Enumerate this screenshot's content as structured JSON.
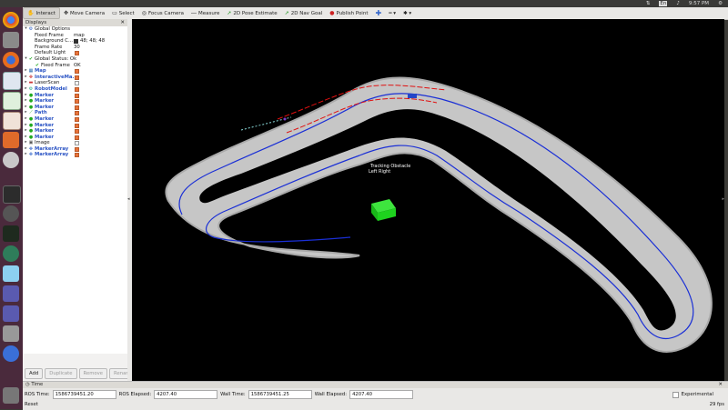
{
  "system_bar": {
    "time": "9:57 PM",
    "indicators": [
      "network-icon",
      "keyboard-icon",
      "volume-icon",
      "power-icon"
    ]
  },
  "toolbar": {
    "tools": [
      {
        "label": "Interact",
        "icon": "interact-icon",
        "active": true
      },
      {
        "label": "Move Camera",
        "icon": "move-camera-icon"
      },
      {
        "label": "Select",
        "icon": "select-icon"
      },
      {
        "label": "Focus Camera",
        "icon": "focus-camera-icon"
      },
      {
        "label": "Measure",
        "icon": "measure-icon"
      },
      {
        "label": "2D Pose Estimate",
        "icon": "pose-estimate-icon"
      },
      {
        "label": "2D Nav Goal",
        "icon": "nav-goal-icon"
      },
      {
        "label": "Publish Point",
        "icon": "publish-point-icon"
      }
    ],
    "extra_icons": [
      "add-tool-icon",
      "remove-tool-icon",
      "tool-options-icon"
    ]
  },
  "displays_panel": {
    "title": "Displays",
    "global_options": {
      "label": "Global Options",
      "fixed_frame": {
        "label": "Fixed Frame",
        "value": "map"
      },
      "background_color": {
        "label": "Background C...",
        "value": "48; 48; 48"
      },
      "frame_rate": {
        "label": "Frame Rate",
        "value": "30"
      },
      "default_light": {
        "label": "Default Light"
      }
    },
    "global_status": {
      "label": "Global Status: Ok",
      "child_label": "Fixed Frame",
      "child_value": "OK"
    },
    "displays": [
      {
        "label": "Map",
        "icon": "map-icon",
        "blue": true,
        "checked": true
      },
      {
        "label": "InteractiveMa...",
        "icon": "interactive-marker-icon",
        "blue": true,
        "checked": true
      },
      {
        "label": "LaserScan",
        "icon": "laserscan-icon",
        "blue": false,
        "checked": false
      },
      {
        "label": "RobotModel",
        "icon": "robot-model-icon",
        "blue": true,
        "checked": true
      },
      {
        "label": "Marker",
        "icon": "marker-icon",
        "blue": true,
        "checked": true
      },
      {
        "label": "Marker",
        "icon": "marker-icon",
        "blue": true,
        "checked": true
      },
      {
        "label": "Marker",
        "icon": "marker-icon",
        "blue": true,
        "checked": true
      },
      {
        "label": "Path",
        "icon": "path-icon",
        "blue": true,
        "checked": true
      },
      {
        "label": "Marker",
        "icon": "marker-icon",
        "blue": true,
        "checked": true
      },
      {
        "label": "Marker",
        "icon": "marker-icon",
        "blue": true,
        "checked": true
      },
      {
        "label": "Marker",
        "icon": "marker-icon",
        "blue": true,
        "checked": true
      },
      {
        "label": "Marker",
        "icon": "marker-icon",
        "blue": true,
        "checked": true
      },
      {
        "label": "Image",
        "icon": "image-icon",
        "blue": false,
        "checked": false
      },
      {
        "label": "MarkerArray",
        "icon": "marker-array-icon",
        "blue": true,
        "checked": true
      },
      {
        "label": "MarkerArray",
        "icon": "marker-array-icon",
        "blue": true,
        "checked": true
      }
    ],
    "buttons": {
      "add": "Add",
      "duplicate": "Duplicate",
      "remove": "Remove",
      "rename": "Rename"
    }
  },
  "viewport": {
    "overlay_text_1": "Tracking Obstacle",
    "overlay_text_2": "Left  Right"
  },
  "time_panel": {
    "title": "Time",
    "ros_time_label": "ROS Time:",
    "ros_time": "1586739451.20",
    "ros_elapsed_label": "ROS Elapsed:",
    "ros_elapsed": "4207.40",
    "wall_time_label": "Wall Time:",
    "wall_time": "1586739451.25",
    "wall_elapsed_label": "Wall Elapsed:",
    "wall_elapsed": "4207.40",
    "experimental_label": "Experimental",
    "reset_label": "Reset",
    "fps": "29 fps"
  },
  "colors": {
    "track": "#c8c8c8",
    "path_blue": "#1a2fd6",
    "boundary_red": "#e01010",
    "obstacle_green": "#1ec81e",
    "launcher": "#4a2a3c"
  }
}
